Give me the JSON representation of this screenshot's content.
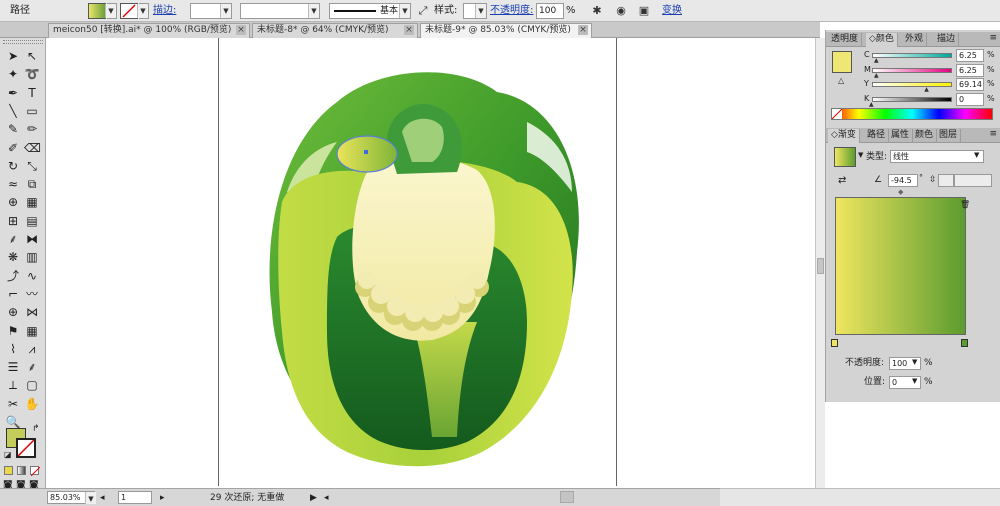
{
  "control_bar": {
    "path_label": "路径",
    "fill_colors": [
      "#e8e46a",
      "#6ca23a"
    ],
    "stroke_label": "描边:",
    "stroke_weight_value": "",
    "stroke_preset_label": "基本",
    "style_label": "样式:",
    "opacity_label": "不透明度:",
    "opacity_value": "100",
    "opacity_unit": "%",
    "transform_label": "变换"
  },
  "tabs": [
    {
      "label": "meicon50 [转换].ai* @ 100% (RGB/预览)",
      "active": false
    },
    {
      "label": "未标题-8* @ 64% (CMYK/预览)",
      "active": false
    },
    {
      "label": "未标题-9* @ 85.03% (CMYK/预览)",
      "active": true
    }
  ],
  "tab_close_glyph": "×",
  "toolbox": {
    "tools": [
      {
        "icon": "selection-arrow-icon",
        "glyph": "➤"
      },
      {
        "icon": "direct-selection-icon",
        "glyph": "↖"
      },
      {
        "icon": "magic-wand-icon",
        "glyph": "✦"
      },
      {
        "icon": "lasso-icon",
        "glyph": "➰"
      },
      {
        "icon": "pen-icon",
        "glyph": "✒"
      },
      {
        "icon": "type-icon",
        "glyph": "T"
      },
      {
        "icon": "line-segment-icon",
        "glyph": "╲"
      },
      {
        "icon": "rectangle-icon",
        "glyph": "▭"
      },
      {
        "icon": "paintbrush-icon",
        "glyph": "✎"
      },
      {
        "icon": "pencil-icon",
        "glyph": "✏"
      },
      {
        "icon": "blob-brush-icon",
        "glyph": "✐"
      },
      {
        "icon": "eraser-icon",
        "glyph": "⌫"
      },
      {
        "icon": "rotate-icon",
        "glyph": "↻"
      },
      {
        "icon": "scale-icon",
        "glyph": "⤡"
      },
      {
        "icon": "warp-icon",
        "glyph": "≈"
      },
      {
        "icon": "free-transform-icon",
        "glyph": "⧉"
      },
      {
        "icon": "shape-builder-icon",
        "glyph": "⊕"
      },
      {
        "icon": "perspective-grid-icon",
        "glyph": "▦"
      },
      {
        "icon": "mesh-icon",
        "glyph": "⊞"
      },
      {
        "icon": "gradient-tool-icon",
        "glyph": "▤"
      },
      {
        "icon": "eyedropper-icon",
        "glyph": "⸙"
      },
      {
        "icon": "blend-icon",
        "glyph": "⧓"
      },
      {
        "icon": "symbol-sprayer-icon",
        "glyph": "❋"
      },
      {
        "icon": "column-graph-icon",
        "glyph": "▥"
      },
      {
        "icon": "anchor-add-icon",
        "glyph": "⤴"
      },
      {
        "icon": "curve-icon",
        "glyph": "∿"
      },
      {
        "icon": "corner-icon",
        "glyph": "⌐"
      },
      {
        "icon": "wave-icon",
        "glyph": "〰"
      },
      {
        "icon": "crosshair-icon",
        "glyph": "⊕"
      },
      {
        "icon": "envelope-icon",
        "glyph": "⋈"
      },
      {
        "icon": "flag-icon",
        "glyph": "⚑"
      },
      {
        "icon": "mesh-grid-icon",
        "glyph": "▦"
      },
      {
        "icon": "wrinkle-icon",
        "glyph": "⌇"
      },
      {
        "icon": "zigzag-icon",
        "glyph": "⩘"
      },
      {
        "icon": "align-icon",
        "glyph": "☰"
      },
      {
        "icon": "dropper-icon",
        "glyph": "⸙"
      },
      {
        "icon": "measure-icon",
        "glyph": "⟂"
      },
      {
        "icon": "slice-icon",
        "glyph": "▢"
      },
      {
        "icon": "scissors-icon",
        "glyph": "✂"
      },
      {
        "icon": "hand-icon",
        "glyph": "✋"
      },
      {
        "icon": "zoom-icon",
        "glyph": "🔍"
      }
    ],
    "fill_color": "#c4cc5a",
    "mode_icons": [
      "color-mode-icon",
      "gradient-mode-icon",
      "none-mode-icon"
    ],
    "screen_mode_icons": [
      "normal-screen-icon",
      "full-menu-screen-icon",
      "full-screen-icon"
    ]
  },
  "status": {
    "zoom": "85.03%",
    "page": "1",
    "undo_text": "29 次还原; 无重做"
  },
  "color_panel": {
    "tabs": [
      "透明度",
      "颜色",
      "外观",
      "描边"
    ],
    "active_tab": 1,
    "swatch": "#efe774",
    "sliders": [
      {
        "letter": "C",
        "value": "6.25",
        "level": 6.25,
        "colors": [
          "#ffffff",
          "#00a99d"
        ]
      },
      {
        "letter": "M",
        "value": "6.25",
        "level": 6.25,
        "colors": [
          "#ffffff",
          "#e4007f"
        ]
      },
      {
        "letter": "Y",
        "value": "69.14",
        "level": 69.14,
        "colors": [
          "#ffffff",
          "#fff100"
        ]
      },
      {
        "letter": "K",
        "value": "0",
        "level": 0,
        "colors": [
          "#ffffff",
          "#000000"
        ]
      }
    ],
    "unit": "%"
  },
  "gradient_panel": {
    "tabs": [
      "渐变",
      "路径",
      "属性",
      "颜色",
      "图层"
    ],
    "active_tab": 0,
    "type_label": "类型:",
    "type_value": "线性",
    "angle_value": "-94.5",
    "angle_unit": "°",
    "start_color": "#efe560",
    "end_color": "#5b9c2f",
    "opacity_label": "不透明度:",
    "opacity_value": "100",
    "location_label": "位置:",
    "location_value": "0",
    "unit": "%"
  }
}
